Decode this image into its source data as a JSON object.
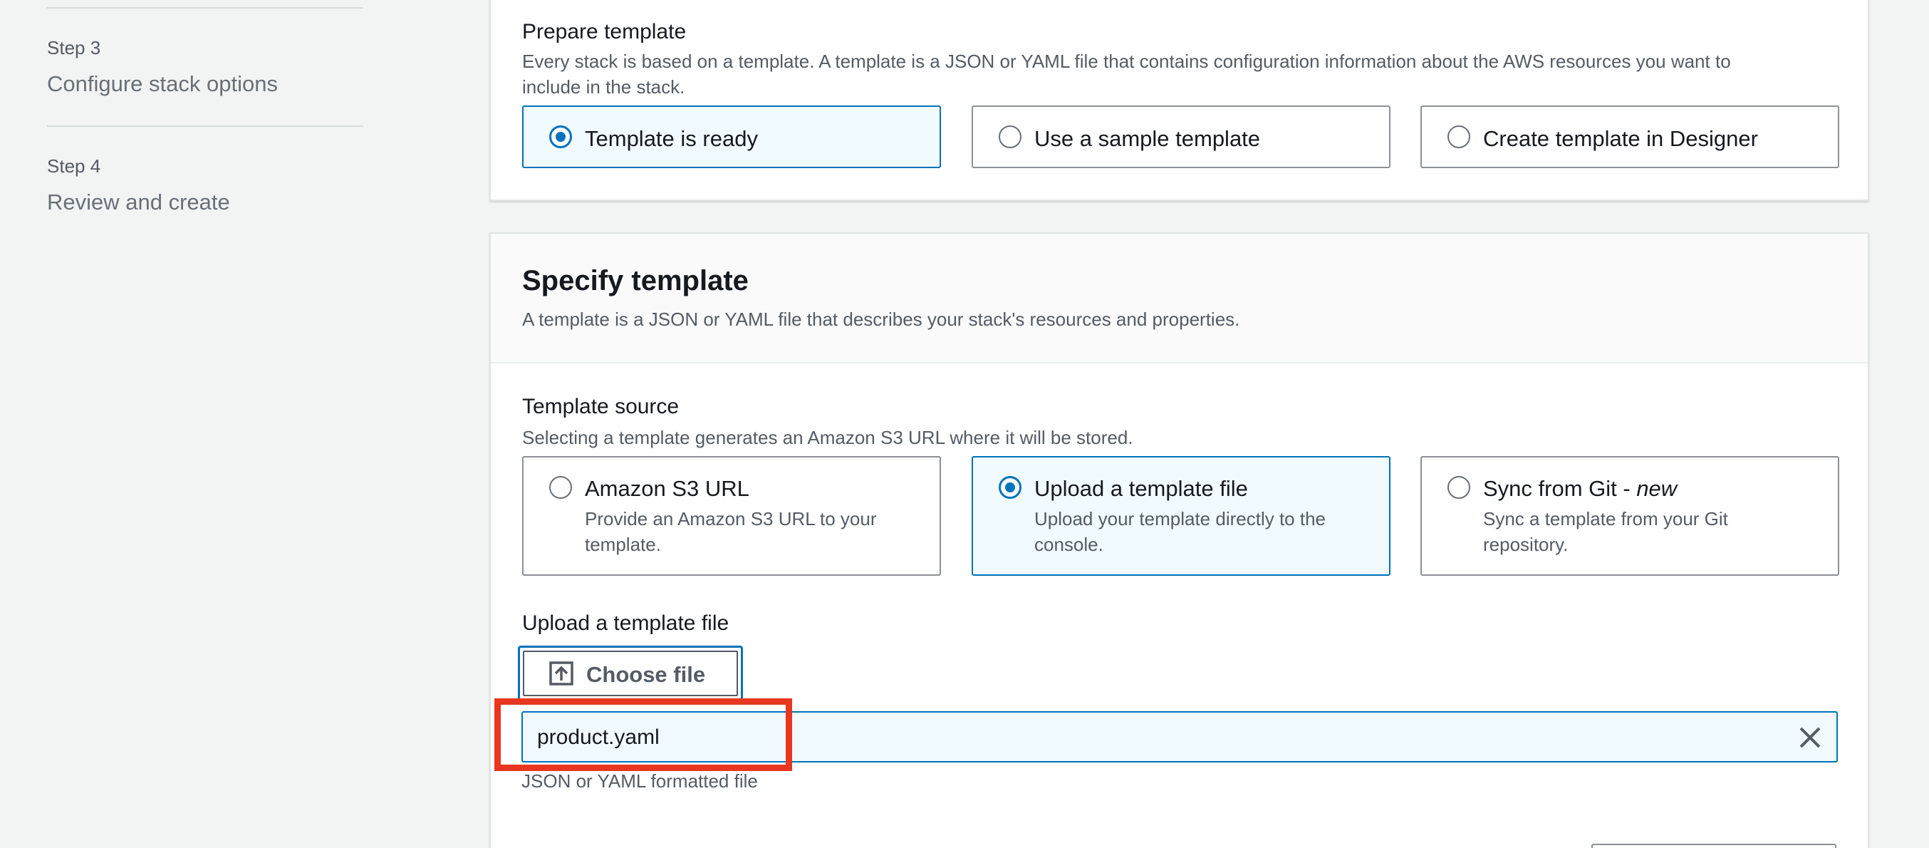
{
  "sidebar": {
    "steps": [
      {
        "label": "Step 3",
        "title": "Configure stack options"
      },
      {
        "label": "Step 4",
        "title": "Review and create"
      }
    ]
  },
  "prepare_template": {
    "label": "Prepare template",
    "description_line1": "Every stack is based on a template. A template is a JSON or YAML file that contains configuration information about the AWS resources you want to",
    "description_line2": "include in the stack.",
    "options": [
      {
        "label": "Template is ready",
        "selected": true
      },
      {
        "label": "Use a sample template",
        "selected": false
      },
      {
        "label": "Create template in Designer",
        "selected": false
      }
    ]
  },
  "specify_template": {
    "title": "Specify template",
    "description": "A template is a JSON or YAML file that describes your stack's resources and properties.",
    "source": {
      "label": "Template source",
      "description": "Selecting a template generates an Amazon S3 URL where it will be stored.",
      "options": [
        {
          "title": "Amazon S3 URL",
          "title_suffix": "",
          "desc_line1": "Provide an Amazon S3 URL to your",
          "desc_line2": "template.",
          "selected": false
        },
        {
          "title": "Upload a template file",
          "title_suffix": "",
          "desc_line1": "Upload your template directly to the",
          "desc_line2": "console.",
          "selected": true
        },
        {
          "title": "Sync from Git - ",
          "title_suffix": "new",
          "desc_line1": "Sync a template from your Git",
          "desc_line2": "repository.",
          "selected": false
        }
      ]
    },
    "upload": {
      "label": "Upload a template file",
      "button_label": "Choose file",
      "file_name": "product.yaml",
      "constraint": "JSON or YAML formatted file"
    }
  },
  "colors": {
    "accent": "#0073bb",
    "selected_bg": "#f1faff",
    "highlight": "#e8361f"
  },
  "icons": [
    "upload-icon",
    "close-icon"
  ]
}
